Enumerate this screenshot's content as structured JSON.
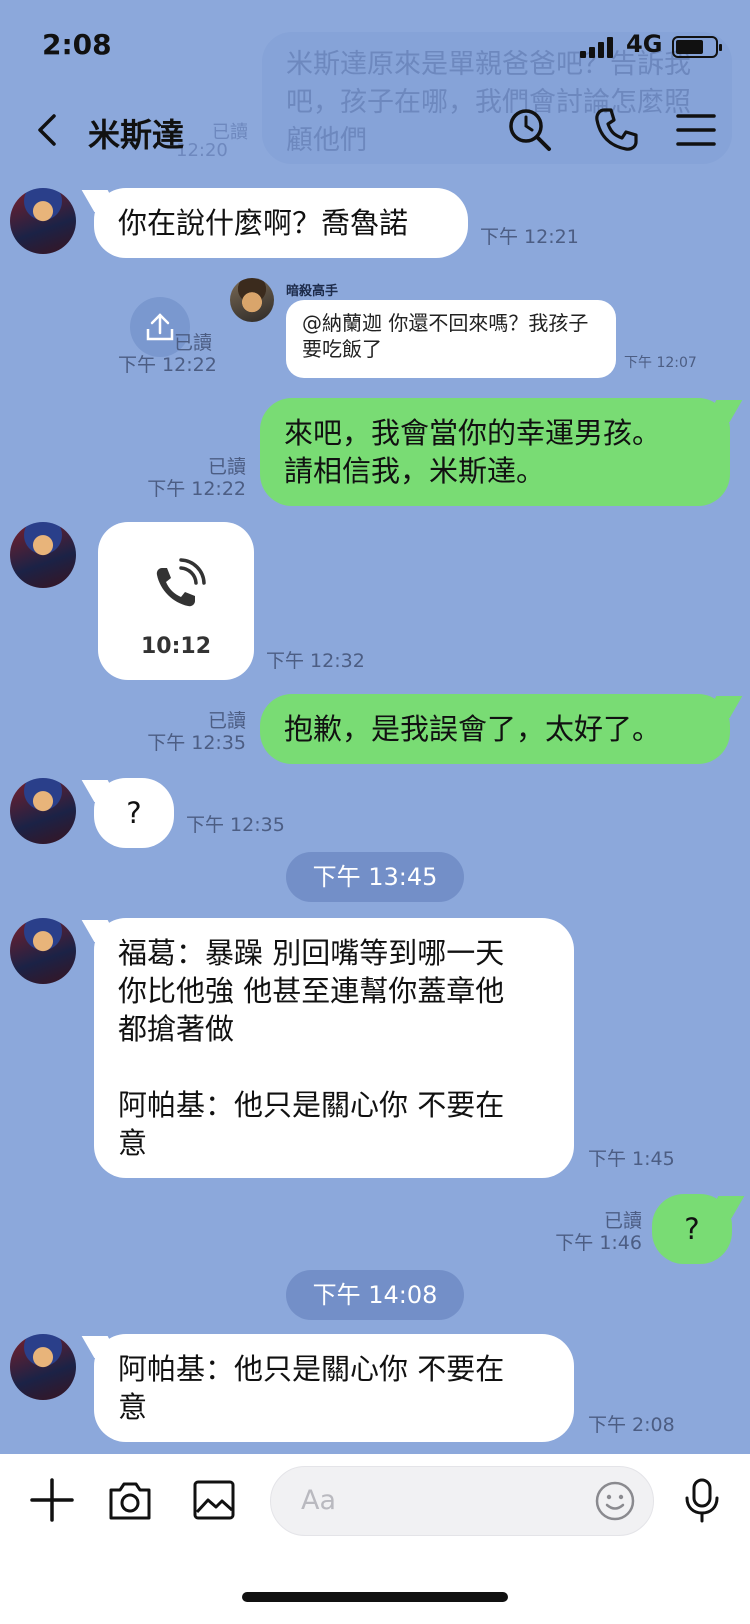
{
  "status_bar": {
    "time": "2:08",
    "network": "4G",
    "battery_level": 0.7
  },
  "header": {
    "title": "米斯達"
  },
  "ghost_message": {
    "text": "米斯達原來是單親爸爸吧？告訴我吧，孩子在哪，我們會討論怎麼照顧他們",
    "read": "已讀",
    "time": "12:20"
  },
  "messages": [
    {
      "id": "m1",
      "text": "你在說什麼啊？喬魯諾",
      "time": "下午 12:21"
    },
    {
      "id": "m2",
      "sender": "暗殺高手",
      "text": "@納蘭迦 你還不回來嗎？我孩子要吃飯了",
      "time": "下午 12:07",
      "read": "已讀",
      "read_time": "下午 12:22"
    },
    {
      "id": "m3",
      "line1": "來吧，我會當你的幸運男孩。",
      "line2": "請相信我，米斯達。",
      "read": "已讀",
      "time": "下午 12:22"
    },
    {
      "id": "m4",
      "call_duration": "10:12",
      "time": "下午 12:32"
    },
    {
      "id": "m5",
      "text": "抱歉，是我誤會了，太好了。",
      "read": "已讀",
      "time": "下午 12:35"
    },
    {
      "id": "m6",
      "text": "?",
      "time": "下午 12:35"
    },
    {
      "id": "d1",
      "date": "下午 13:45"
    },
    {
      "id": "m7",
      "line1": "福葛：暴躁 別回嘴等到哪一天",
      "line2": "你比他強 他甚至連幫你蓋章他",
      "line3": "都搶著做",
      "line4": "阿帕基：他只是關心你 不要在",
      "line5": "意",
      "time": "下午 1:45"
    },
    {
      "id": "m8",
      "text": "?",
      "read": "已讀",
      "time": "下午 1:46"
    },
    {
      "id": "d2",
      "date": "下午 14:08"
    },
    {
      "id": "m9",
      "line1": "阿帕基：他只是關心你 不要在",
      "line2": "意",
      "time": "下午 2:08"
    }
  ],
  "composer": {
    "placeholder": "Aa"
  },
  "colors": {
    "background": "#8CA8DB",
    "own_bubble": "#79DC74",
    "other_bubble": "#FFFFFF"
  }
}
